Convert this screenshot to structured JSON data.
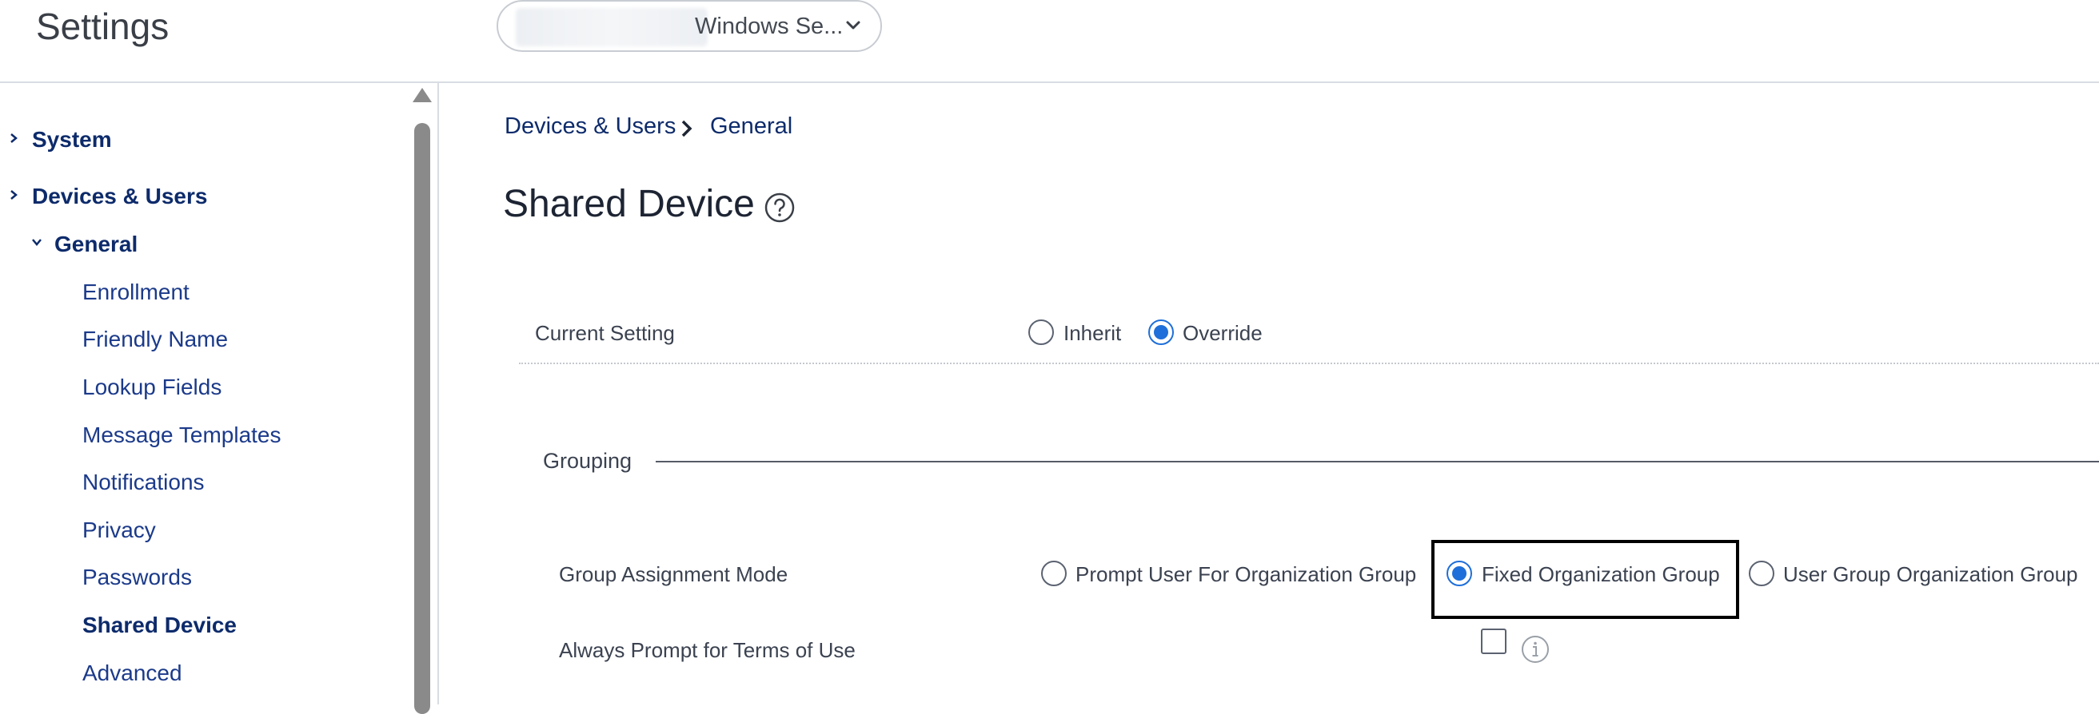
{
  "header": {
    "title": "Settings",
    "org_selector": {
      "label": "Windows Se...",
      "icon": "chevron-down-icon"
    }
  },
  "sidebar": {
    "items": [
      {
        "label": "System",
        "level": "top",
        "expanded": false
      },
      {
        "label": "Devices & Users",
        "level": "top",
        "expanded": false
      },
      {
        "label": "General",
        "level": "group",
        "expanded": true
      },
      {
        "label": "Enrollment",
        "level": "sub"
      },
      {
        "label": "Friendly Name",
        "level": "sub"
      },
      {
        "label": "Lookup Fields",
        "level": "sub"
      },
      {
        "label": "Message Templates",
        "level": "sub"
      },
      {
        "label": "Notifications",
        "level": "sub"
      },
      {
        "label": "Privacy",
        "level": "sub"
      },
      {
        "label": "Passwords",
        "level": "sub"
      },
      {
        "label": "Shared Device",
        "level": "sub",
        "active": true
      },
      {
        "label": "Advanced",
        "level": "sub"
      }
    ]
  },
  "breadcrumb": [
    "Devices & Users",
    "General"
  ],
  "page": {
    "title": "Shared Device"
  },
  "current_setting": {
    "label": "Current Setting",
    "options": [
      "Inherit",
      "Override"
    ],
    "selected": "Override"
  },
  "grouping": {
    "section_title": "Grouping",
    "assignment_mode": {
      "label": "Group Assignment Mode",
      "options": [
        "Prompt User For Organization Group",
        "Fixed Organization Group",
        "User Group Organization Group"
      ],
      "selected": "Fixed Organization Group"
    },
    "terms_of_use": {
      "label": "Always Prompt for Terms of Use",
      "checked": false
    }
  },
  "colors": {
    "accent": "#1e6fd9",
    "nav_text": "#0d2b6b",
    "highlight_border": "#000000"
  }
}
